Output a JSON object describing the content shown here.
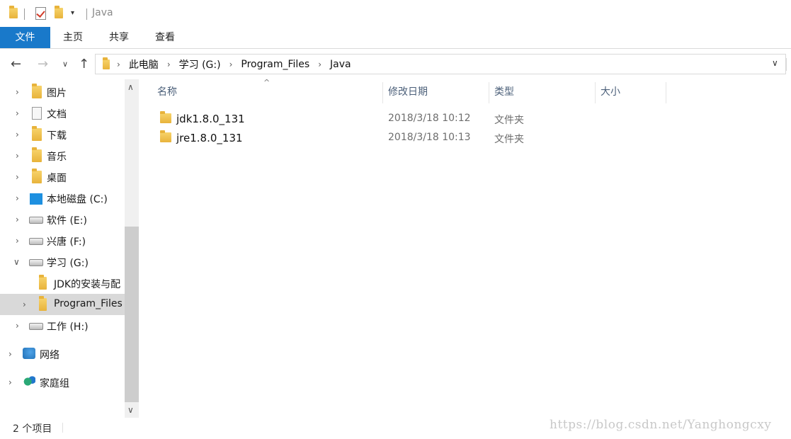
{
  "window": {
    "title": "Java"
  },
  "ribbon": {
    "tabs": [
      "文件",
      "主页",
      "共享",
      "查看"
    ]
  },
  "nav": {
    "back_icon": "arrow-left-icon",
    "forward_icon": "arrow-right-icon",
    "recent_icon": "chevron-down-icon",
    "up_icon": "arrow-up-icon"
  },
  "breadcrumb": [
    "此电脑",
    "学习 (G:)",
    "Program_Files",
    "Java"
  ],
  "sidebar": {
    "items": [
      {
        "label": "图片",
        "icon": "pictures-folder-icon"
      },
      {
        "label": "文档",
        "icon": "documents-folder-icon"
      },
      {
        "label": "下载",
        "icon": "downloads-folder-icon"
      },
      {
        "label": "音乐",
        "icon": "music-folder-icon"
      },
      {
        "label": "桌面",
        "icon": "desktop-folder-icon"
      },
      {
        "label": "本地磁盘 (C:)",
        "icon": "windows-drive-icon"
      },
      {
        "label": "软件 (E:)",
        "icon": "drive-icon"
      },
      {
        "label": "兴唐 (F:)",
        "icon": "drive-icon"
      },
      {
        "label": "学习 (G:)",
        "icon": "drive-icon"
      },
      {
        "label": "JDK的安装与配",
        "icon": "folder-icon"
      },
      {
        "label": "Program_Files",
        "icon": "folder-icon"
      },
      {
        "label": "工作 (H:)",
        "icon": "drive-icon"
      },
      {
        "label": "网络",
        "icon": "network-icon"
      },
      {
        "label": "家庭组",
        "icon": "homegroup-icon"
      }
    ]
  },
  "columns": {
    "name": "名称",
    "date": "修改日期",
    "type": "类型",
    "size": "大小"
  },
  "files": [
    {
      "name": "jdk1.8.0_131",
      "date": "2018/3/18 10:12",
      "type": "文件夹"
    },
    {
      "name": "jre1.8.0_131",
      "date": "2018/3/18 10:13",
      "type": "文件夹"
    }
  ],
  "status": {
    "count": "2 个项目"
  },
  "watermark": "https://blog.csdn.net/Yanghongcxy",
  "colors": {
    "accent": "#1979ca",
    "folder": "#f2c04e",
    "selected_bg": "#d9d9d9"
  }
}
